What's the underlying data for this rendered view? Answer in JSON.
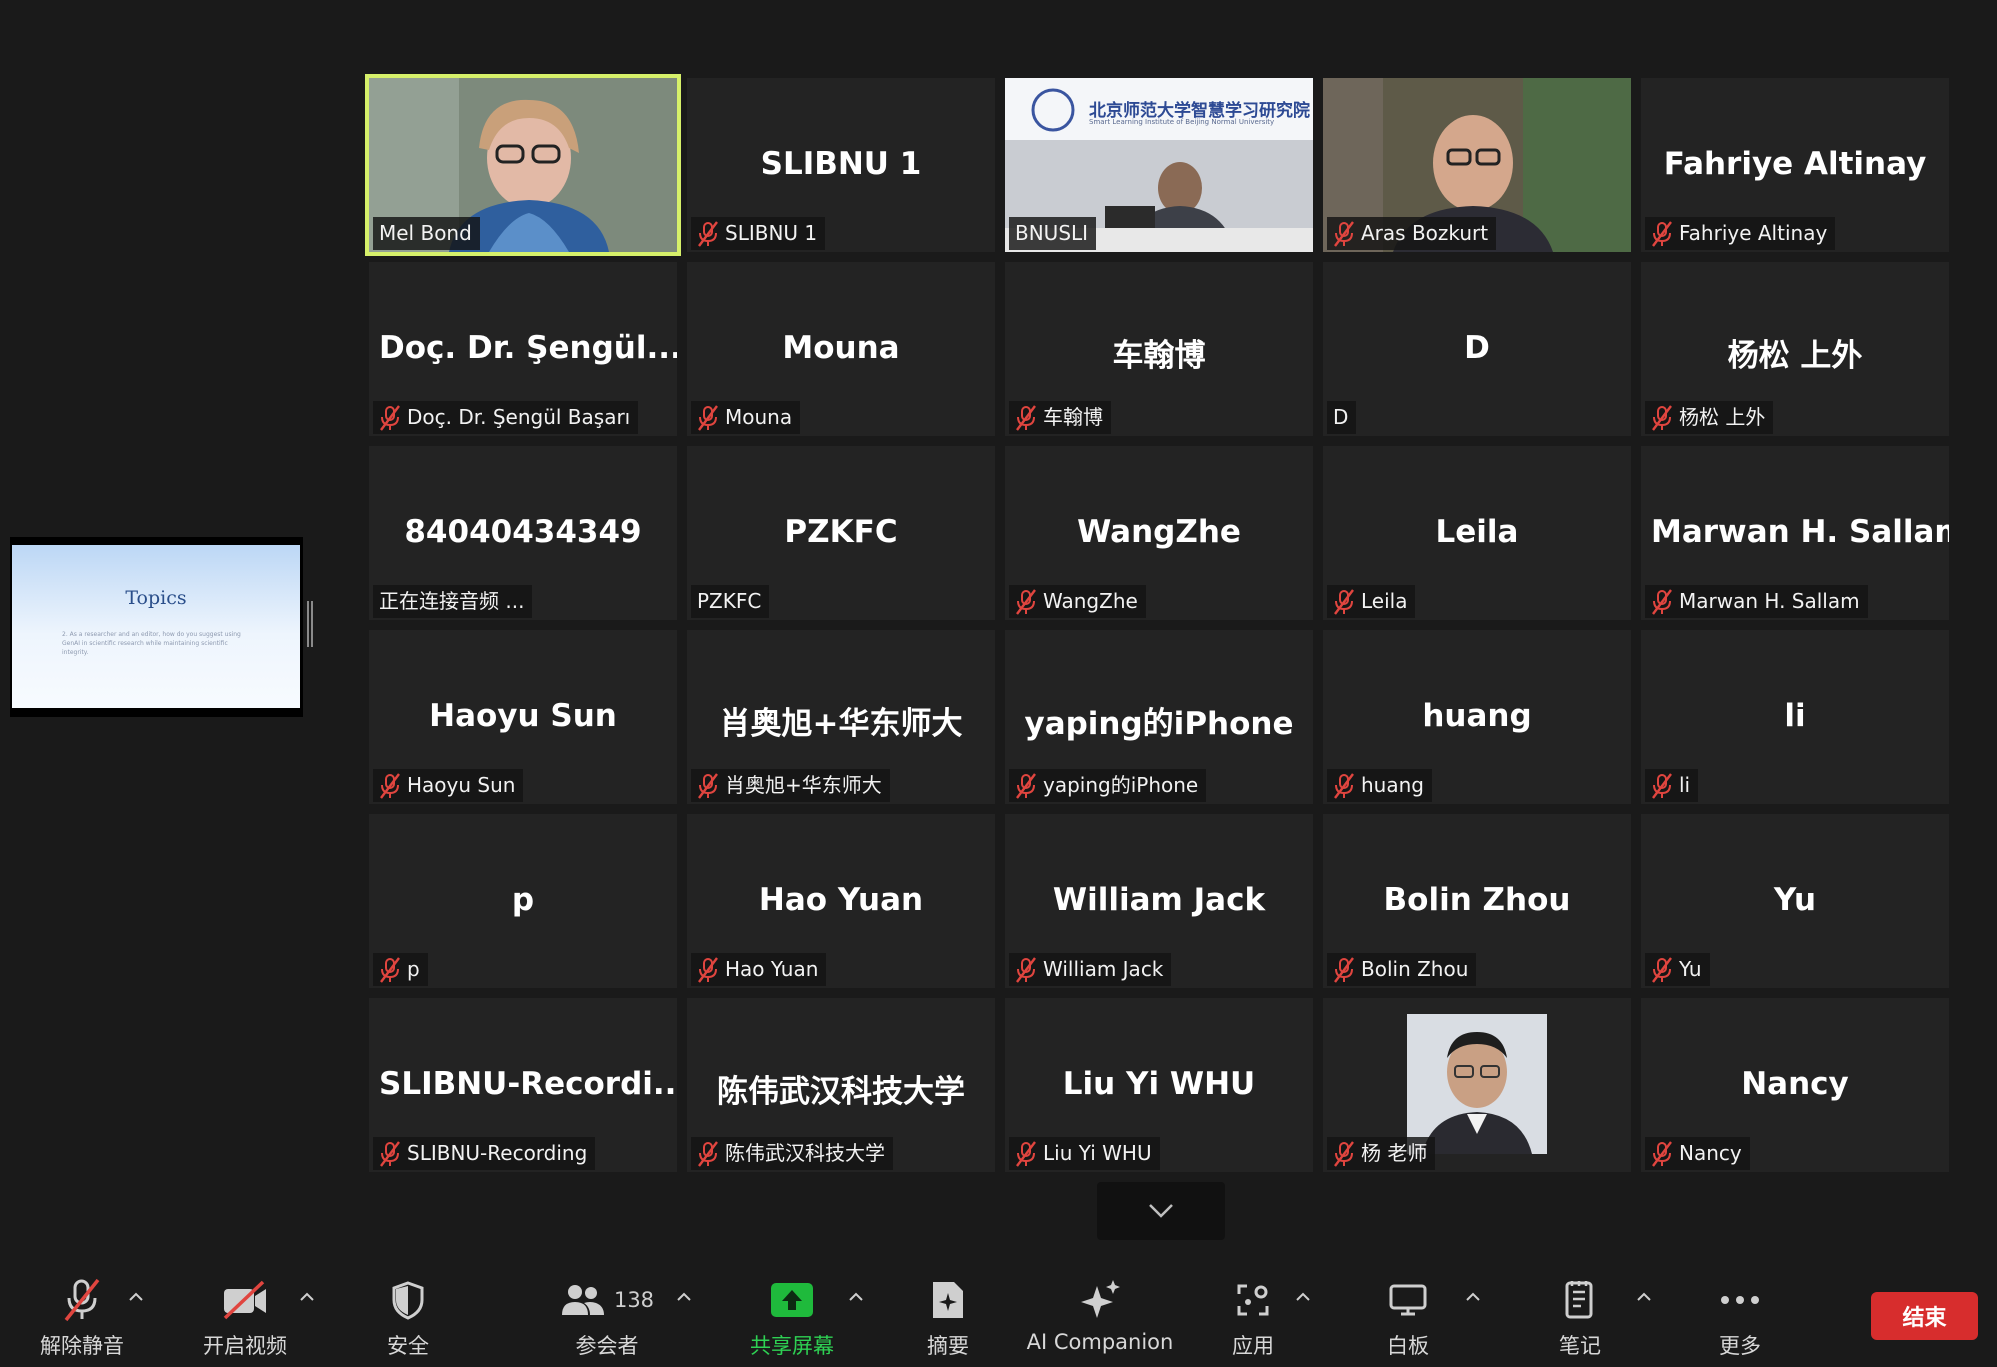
{
  "shared_screen": {
    "slide_title": "Topics",
    "slide_text": "2. As a researcher and an editor, how do you suggest using GenAI in scientific research while maintaining scientific integrity."
  },
  "tiles": [
    {
      "display": "",
      "label": "Mel Bond",
      "muted": false,
      "video": "person-video",
      "active": true
    },
    {
      "display": "SLIBNU 1",
      "label": "SLIBNU 1",
      "muted": true
    },
    {
      "display": "",
      "label": "BNUSLI",
      "muted": false,
      "video": "room-video",
      "banner": "北京师范大学智慧学习研究院",
      "banner_sub": "Smart Learning Institute of Beijing Normal University"
    },
    {
      "display": "",
      "label": "Aras Bozkurt",
      "muted": true,
      "video": "person-video"
    },
    {
      "display": "Fahriye Altinay",
      "label": "Fahriye Altinay",
      "muted": true
    },
    {
      "display": "Doç. Dr. Şengül...",
      "label": "Doç. Dr. Şengül Başarı",
      "muted": true
    },
    {
      "display": "Mouna",
      "label": "Mouna",
      "muted": true
    },
    {
      "display": "车翰博",
      "label": "车翰博",
      "muted": true
    },
    {
      "display": "D",
      "label": "D",
      "muted": false
    },
    {
      "display": "杨松 上外",
      "label": "杨松 上外",
      "muted": true
    },
    {
      "display": "84040434349",
      "label": "正在连接音频 ...",
      "muted": false
    },
    {
      "display": "PZKFC",
      "label": "PZKFC",
      "muted": false
    },
    {
      "display": "WangZhe",
      "label": "WangZhe",
      "muted": true
    },
    {
      "display": "Leila",
      "label": "Leila",
      "muted": true
    },
    {
      "display": "Marwan H. Sallam",
      "label": "Marwan H. Sallam",
      "muted": true
    },
    {
      "display": "Haoyu Sun",
      "label": "Haoyu Sun",
      "muted": true
    },
    {
      "display": "肖奥旭+华东师大",
      "label": "肖奥旭+华东师大",
      "muted": true
    },
    {
      "display": "yaping的iPhone",
      "label": "yaping的iPhone",
      "muted": true
    },
    {
      "display": "huang",
      "label": "huang",
      "muted": true
    },
    {
      "display": "li",
      "label": "li",
      "muted": true
    },
    {
      "display": "p",
      "label": "p",
      "muted": true
    },
    {
      "display": "Hao Yuan",
      "label": "Hao Yuan",
      "muted": true
    },
    {
      "display": "William Jack",
      "label": "William Jack",
      "muted": true
    },
    {
      "display": "Bolin Zhou",
      "label": "Bolin Zhou",
      "muted": true
    },
    {
      "display": "Yu",
      "label": "Yu",
      "muted": true
    },
    {
      "display": "SLIBNU-Recordi...",
      "label": "SLIBNU-Recording",
      "muted": true
    },
    {
      "display": "陈伟武汉科技大学",
      "label": "陈伟武汉科技大学",
      "muted": true
    },
    {
      "display": "Liu Yi WHU",
      "label": "Liu Yi WHU",
      "muted": true
    },
    {
      "display": "",
      "label": "杨 老师",
      "muted": true,
      "video": "profile-photo"
    },
    {
      "display": "Nancy",
      "label": "Nancy",
      "muted": true
    }
  ],
  "toolbar": {
    "unmute": "解除静音",
    "start_video": "开启视频",
    "security": "安全",
    "participants": "参会者",
    "participants_count": "138",
    "share_screen": "共享屏幕",
    "summary": "摘要",
    "ai_companion": "AI Companion",
    "apps": "应用",
    "whiteboard": "白板",
    "notes": "笔记",
    "more": "更多",
    "end": "结束"
  },
  "colors": {
    "active_speaker_border": "#d6f06a",
    "share_green": "#1fba3c",
    "end_red": "#d72d2d",
    "muted_red": "#e0453f"
  }
}
